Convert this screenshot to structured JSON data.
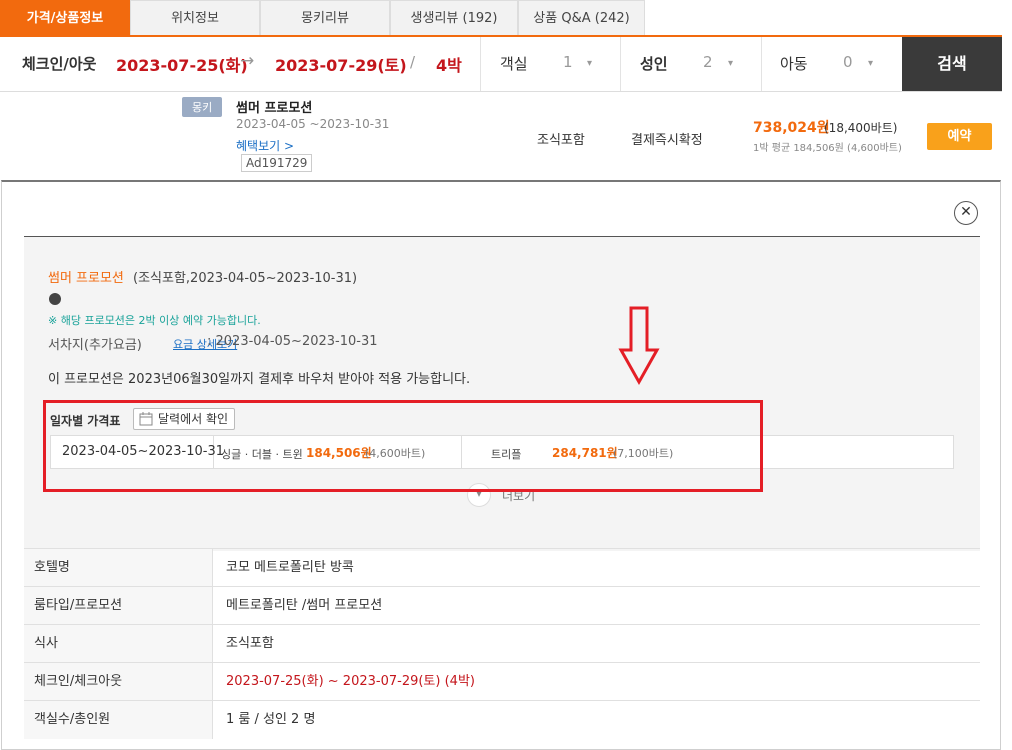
{
  "tabs": [
    {
      "label": "가격/상품정보",
      "active": true
    },
    {
      "label": "위치정보",
      "active": false
    },
    {
      "label": "몽키리뷰",
      "active": false
    },
    {
      "label": "생생리뷰 (192)",
      "active": false
    },
    {
      "label": "상품 Q&A (242)",
      "active": false
    }
  ],
  "search": {
    "checkin_label": "체크인/아웃",
    "checkin": "2023-07-25(화)",
    "arrow": "→",
    "checkout": "2023-07-29(토)",
    "slash": "/",
    "nights": "4박",
    "rooms_label": "객실",
    "rooms": "1",
    "adults_label": "성인",
    "adults": "2",
    "children_label": "아동",
    "children": "0",
    "button": "검색"
  },
  "offer": {
    "badge": "몽키",
    "name": "썸머 프로모션",
    "period": "2023-04-05 ~2023-10-31",
    "benefit_link": "혜택보기 >",
    "code": "Ad191729",
    "meal": "조식포함",
    "payment": "결제즉시확정",
    "price": "738,024원",
    "price_baht": "(18,400바트)",
    "avg": "1박 평균 184,506원 (4,600바트)",
    "reserve": "예약"
  },
  "detail": {
    "close": "✕",
    "promo_name": "썸머 프로모션",
    "promo_info": "(조식포함,2023-04-05~2023-10-31)",
    "notice": "※ 해당 프로모션은 2박 이상 예약 가능합니다.",
    "surcharge_label": "서차지(추가요금)",
    "surcharge_link": "요금 상세보기",
    "surcharge_period": ": 2023-04-05~2023-10-31",
    "voucher_note": "이 프로모션은 2023년06월30일까지 결제후 바우처 받아야 적용 가능합니다.",
    "price_table_title": "일자별 가격표",
    "calendar_button": "달력에서 확인",
    "table_period": "2023-04-05~2023-10-31",
    "single_label": "싱글 · 더블 · 트윈",
    "single_price": "184,506원",
    "single_baht": "(4,600바트)",
    "triple_label": "트리플",
    "triple_price": "284,781원",
    "triple_baht": "(7,100바트)",
    "more": "더보기"
  },
  "info_rows": [
    {
      "key": "호텔명",
      "value": "코모 메트로폴리탄 방콕"
    },
    {
      "key": "룸타입/프로모션",
      "value": "메트로폴리탄 /썸머 프로모션"
    },
    {
      "key": "식사",
      "value": "조식포함"
    },
    {
      "key": "체크인/체크아웃",
      "value": "2023-07-25(화) ~ 2023-07-29(토) (4박)"
    },
    {
      "key": "객실수/총인원",
      "value": "1 룸 / 성인 2 명"
    }
  ],
  "colors": {
    "accent": "#f26a0e",
    "red": "#c4161c",
    "highlight_box": "#e41e26",
    "notice": "#1aa39a"
  },
  "icons": [
    "calendar-icon",
    "close-icon",
    "chevron-down-icon",
    "down-arrow-annotation"
  ]
}
